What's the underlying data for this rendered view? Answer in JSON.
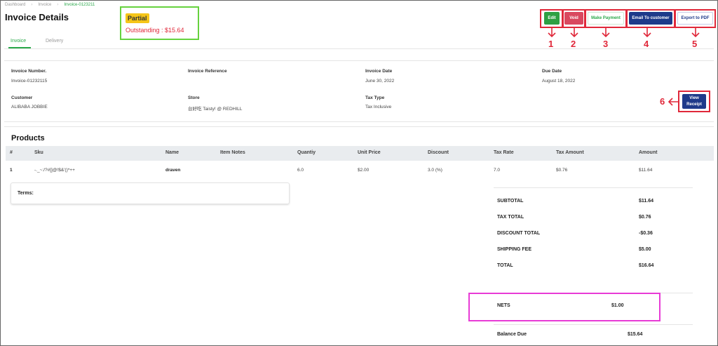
{
  "breadcrumb": {
    "items": [
      "Dashboard",
      "Invoice",
      "Invoice-0123211"
    ]
  },
  "header": {
    "title": "Invoice Details",
    "status_badge": "Partial",
    "outstanding": "Outstanding : $15.64"
  },
  "tabs": [
    "Invoice",
    "Delivery"
  ],
  "actions": {
    "edit": "Edit",
    "void": "Void",
    "make_payment": "Make Payment",
    "email": "Email To customer",
    "export_pdf": "Export to PDF",
    "view_receipt_line1": "View",
    "view_receipt_line2": "Receipt"
  },
  "annotations": [
    "1",
    "2",
    "3",
    "4",
    "5",
    "6"
  ],
  "info": {
    "invoice_number_label": "Invoice Number.",
    "invoice_number": "Invoice-01232115",
    "invoice_reference_label": "Invoice Reference",
    "invoice_reference": "",
    "invoice_date_label": "Invoice Date",
    "invoice_date": "June 30, 2022",
    "due_date_label": "Due Date",
    "due_date": "August 18, 2022",
    "customer_label": "Customer",
    "customer": "ALIBABA JOBBIE",
    "store_label": "Store",
    "store": "台好吃 Taisty! @ REDHILL",
    "tax_type_label": "Tax Type",
    "tax_type": "Tax Inclusive"
  },
  "products": {
    "title": "Products",
    "columns": [
      "#",
      "Sku",
      "Name",
      "Item Notes",
      "Quantiy",
      "Unit Price",
      "Discount",
      "Tax Rate",
      "Tax Amount",
      "Amount"
    ],
    "rows": [
      [
        "1",
        "-._~:/?#[]@!$&'()*++",
        "draven",
        "",
        "6.0",
        "$2.00",
        "3.0 (%)",
        "7.0",
        "$0.76",
        "$11.64"
      ]
    ]
  },
  "terms_label": "Terms:",
  "summary": {
    "subtotal_label": "SUBTOTAL",
    "subtotal": "$11.64",
    "tax_total_label": "TAX TOTAL",
    "tax_total": "$0.76",
    "discount_total_label": "DISCOUNT TOTAL",
    "discount_total": "-$0.36",
    "shipping_fee_label": "SHIPPING FEE",
    "shipping_fee": "$5.00",
    "total_label": "TOTAL",
    "total": "$16.64",
    "nets_label": "NETS",
    "nets": "$1.00",
    "balance_due_label": "Balance Due",
    "balance_due": "$15.64"
  },
  "colors": {
    "green": "#2ea043",
    "void_red": "#d9485f",
    "navy": "#1e3a8a",
    "annotation_red": "#e0283a",
    "highlight_green": "#66d23e",
    "highlight_magenta": "#e83bd6",
    "badge_yellow": "#f5c518"
  }
}
